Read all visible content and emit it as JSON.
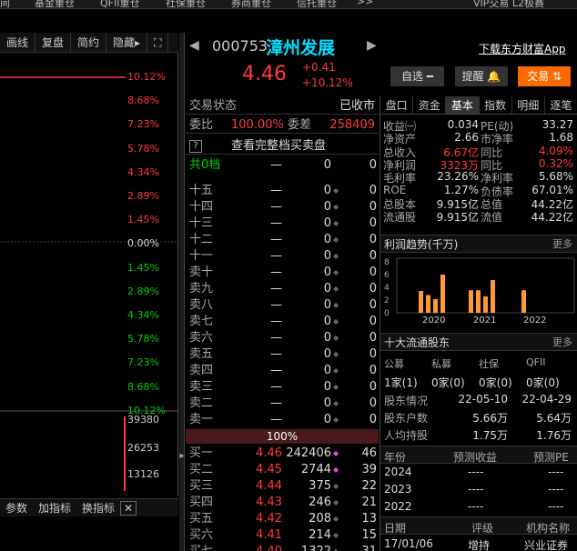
{
  "topnav": [
    "间",
    "基金重仓",
    "QFII重仓",
    "社保重仓",
    "券商重仓",
    "信托重仓",
    ">>",
    "VIP交易 L2极赛"
  ],
  "toolbar": [
    "画线",
    "复盘",
    "简约",
    "隐藏▸",
    "⛶"
  ],
  "pct_labels": [
    {
      "t": "10.12%",
      "c": "red"
    },
    {
      "t": "8.68%",
      "c": "red"
    },
    {
      "t": "7.23%",
      "c": "red"
    },
    {
      "t": "5.78%",
      "c": "red"
    },
    {
      "t": "4.34%",
      "c": "red"
    },
    {
      "t": "2.89%",
      "c": "red"
    },
    {
      "t": "1.45%",
      "c": "red"
    },
    {
      "t": "0.00%",
      "c": "white"
    },
    {
      "t": "1.45%",
      "c": "green"
    },
    {
      "t": "2.89%",
      "c": "green"
    },
    {
      "t": "4.34%",
      "c": "green"
    },
    {
      "t": "5.78%",
      "c": "green"
    },
    {
      "t": "7.23%",
      "c": "green"
    },
    {
      "t": "8.68%",
      "c": "green"
    },
    {
      "t": "10.12%",
      "c": "green"
    }
  ],
  "vol_labels": [
    "39380",
    "26253",
    "13126"
  ],
  "bottombar": [
    "参数",
    "加指标",
    "换指标",
    "✕"
  ],
  "header": {
    "code": "000753",
    "name": "漳州发展",
    "price": "4.46",
    "change": "+0.41",
    "change_pct": "+10.12%",
    "download": "下载东方财富App",
    "btn_watch": "自选 ━",
    "btn_alert": "提醒 🔔",
    "btn_trade": "交易 ⇅"
  },
  "status": {
    "label": "交易状态",
    "value": "已收市"
  },
  "ratio": {
    "l1": "委比",
    "v1": "100.00%",
    "l2": "委差",
    "v2": "258409"
  },
  "full_book": "查看完整档买卖盘",
  "book_head": {
    "n": "共0档",
    "p": "—",
    "v": "0",
    "c": "0"
  },
  "asks": [
    {
      "n": "十五"
    },
    {
      "n": "十四"
    },
    {
      "n": "十三"
    },
    {
      "n": "十二"
    },
    {
      "n": "十一"
    },
    {
      "n": "卖十"
    },
    {
      "n": "卖九"
    },
    {
      "n": "卖八"
    },
    {
      "n": "卖七"
    },
    {
      "n": "卖六"
    },
    {
      "n": "卖五"
    },
    {
      "n": "卖四"
    },
    {
      "n": "卖三"
    },
    {
      "n": "卖二"
    },
    {
      "n": "卖一"
    }
  ],
  "ask_dash": "—",
  "ask_zero": "0",
  "mid_pct": "100%",
  "bids": [
    {
      "n": "买一",
      "p": "4.46",
      "v": "242406",
      "c": "46"
    },
    {
      "n": "买二",
      "p": "4.45",
      "v": "2744",
      "c": "39"
    },
    {
      "n": "买三",
      "p": "4.44",
      "v": "375",
      "c": "22"
    },
    {
      "n": "买四",
      "p": "4.43",
      "v": "246",
      "c": "21"
    },
    {
      "n": "买五",
      "p": "4.42",
      "v": "208",
      "c": "13"
    },
    {
      "n": "买六",
      "p": "4.41",
      "v": "214",
      "c": "15"
    },
    {
      "n": "买七",
      "p": "4.40",
      "v": "1322",
      "c": "31"
    }
  ],
  "rtabs": [
    "盘口",
    "资金",
    "基本",
    "指数",
    "明细",
    "逐笔"
  ],
  "fund": [
    [
      "收益㈠",
      "0.034",
      "PE(动)",
      "33.27"
    ],
    [
      "净资产",
      "2.66",
      "市净率",
      "1.68"
    ],
    [
      "总收入",
      "6.67亿",
      "同比",
      "4.09%"
    ],
    [
      "净利润",
      "3323万",
      "同比",
      "0.32%"
    ],
    [
      "毛利率",
      "23.26%",
      "净利率",
      "5.68%"
    ],
    [
      "ROE",
      "1.27%",
      "负债率",
      "67.01%"
    ],
    [
      "总股本",
      "9.915亿",
      "总值",
      "44.22亿"
    ],
    [
      "流通股",
      "9.915亿",
      "流值",
      "44.22亿"
    ]
  ],
  "profit": {
    "title": "利润趋势(千万)",
    "more": "更多",
    "yticks": [
      "8",
      "6",
      "4",
      "2",
      "0"
    ],
    "years": [
      "2020",
      "2021",
      "2022"
    ]
  },
  "holders": {
    "title": "十大流通股东",
    "more": "更多",
    "cols": [
      "公募",
      "私募",
      "社保",
      "QFII"
    ],
    "vals": [
      "1家(1)",
      "0家(0)",
      "0家(0)",
      "0家(0)"
    ],
    "rows": [
      [
        "股东情况",
        "22-05-10",
        "22-04-29"
      ],
      [
        "股东户数",
        "5.66万",
        "5.64万"
      ],
      [
        "人均持股",
        "1.75万",
        "1.76万"
      ]
    ]
  },
  "forecast": {
    "cols": [
      "年份",
      "预测收益",
      "预测PE"
    ],
    "rows": [
      [
        "2024",
        "----",
        "----"
      ],
      [
        "2023",
        "----",
        "----"
      ],
      [
        "2022",
        "----",
        "----"
      ]
    ]
  },
  "rating": {
    "cols": [
      "日期",
      "评级",
      "机构名称"
    ],
    "row": [
      "17/01/06",
      "增持",
      "兴业证券"
    ]
  },
  "colors": {
    "up": "#ff3b3b",
    "down": "#00d000",
    "bar": "#ff9933",
    "accent": "#ff6a00"
  }
}
